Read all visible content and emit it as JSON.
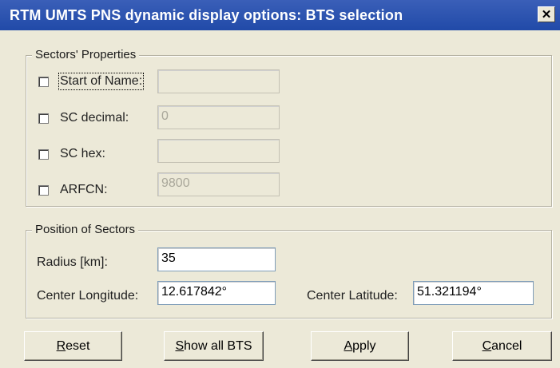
{
  "window": {
    "title": "RTM UMTS PNS dynamic display options: BTS selection",
    "close_glyph": "✕"
  },
  "sectors_properties": {
    "legend": "Sectors' Properties",
    "rows": [
      {
        "label": "Start of Name:",
        "value": "",
        "checked": false,
        "enabled": false
      },
      {
        "label": "SC decimal:",
        "value": "0",
        "checked": false,
        "enabled": false
      },
      {
        "label": "SC hex:",
        "value": "",
        "checked": false,
        "enabled": false
      },
      {
        "label": "ARFCN:",
        "value": "9800",
        "checked": false,
        "enabled": false
      }
    ]
  },
  "position_of_sectors": {
    "legend": "Position of Sectors",
    "radius_label": "Radius [km]:",
    "radius_value": "35",
    "center_longitude_label": "Center Longitude:",
    "center_longitude_value": "12.617842°",
    "center_latitude_label": "Center Latitude:",
    "center_latitude_value": "51.321194°"
  },
  "buttons": {
    "reset": {
      "mnemonic": "R",
      "rest": "eset"
    },
    "show_all_bts": {
      "mnemonic": "S",
      "rest": "how all BTS"
    },
    "apply": {
      "mnemonic": "A",
      "rest": "pply"
    },
    "cancel": {
      "mnemonic": "C",
      "rest": "ancel"
    }
  },
  "colors": {
    "titlebar": "#214aa8",
    "dialog_background": "#ECE9D8"
  }
}
